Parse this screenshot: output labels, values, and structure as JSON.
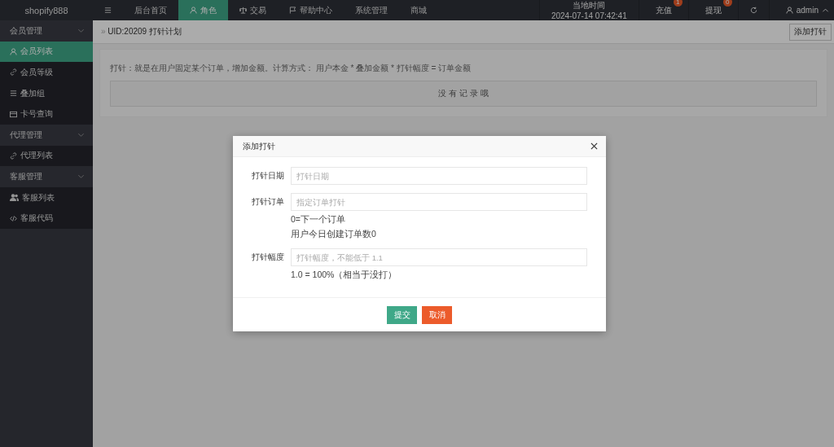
{
  "topbar": {
    "logo": "shopify888",
    "nav": [
      {
        "label": "后台首页",
        "selected": false
      },
      {
        "label": "角色",
        "selected": true
      },
      {
        "label": "交易",
        "selected": false
      },
      {
        "label": "帮助中心",
        "selected": false
      },
      {
        "label": "系统管理",
        "selected": false
      },
      {
        "label": "商城",
        "selected": false
      }
    ],
    "clock": {
      "label": "当地时间",
      "value": "2024-07-14 07:42:41"
    },
    "actions": [
      {
        "label": "充值",
        "badge": "1"
      },
      {
        "label": "提现",
        "badge": "0"
      }
    ],
    "user": "admin"
  },
  "sidebar": {
    "groups": [
      {
        "label": "会员管理",
        "expanded": true,
        "children": [
          {
            "label": "会员列表",
            "selected": true
          },
          {
            "label": "会员等级",
            "selected": false
          },
          {
            "label": "叠加组",
            "selected": false
          },
          {
            "label": "卡号查询",
            "selected": false
          }
        ]
      },
      {
        "label": "代理管理",
        "expanded": true,
        "children": [
          {
            "label": "代理列表",
            "selected": false
          }
        ]
      },
      {
        "label": "客服管理",
        "expanded": true,
        "children": [
          {
            "label": "客服列表",
            "selected": false
          },
          {
            "label": "客服代码",
            "selected": false
          }
        ]
      }
    ]
  },
  "page": {
    "breadcrumb_separator": "»",
    "breadcrumb": "UID:20209 打针计划",
    "add_button": "添加打针",
    "hint": "打针：就是在用户固定某个订单，增加金额。计算方式： 用户本金 * 叠加金额 * 打针幅度 = 订单金额",
    "empty": "没 有 记 录 哦"
  },
  "modal": {
    "title": "添加打针",
    "fields": [
      {
        "label": "打针日期",
        "placeholder": "打针日期"
      },
      {
        "label": "打针订单",
        "placeholder": "指定订单打针",
        "notes": [
          "0=下一个订单",
          "用户今日创建订单数0"
        ]
      },
      {
        "label": "打针幅度",
        "placeholder": "打针幅度，不能低于 1.1",
        "notes": [
          "1.0 = 100%（相当于没打）"
        ]
      }
    ],
    "buttons": [
      {
        "label": "提交",
        "kind": "primary"
      },
      {
        "label": "取消",
        "kind": "danger"
      }
    ]
  }
}
